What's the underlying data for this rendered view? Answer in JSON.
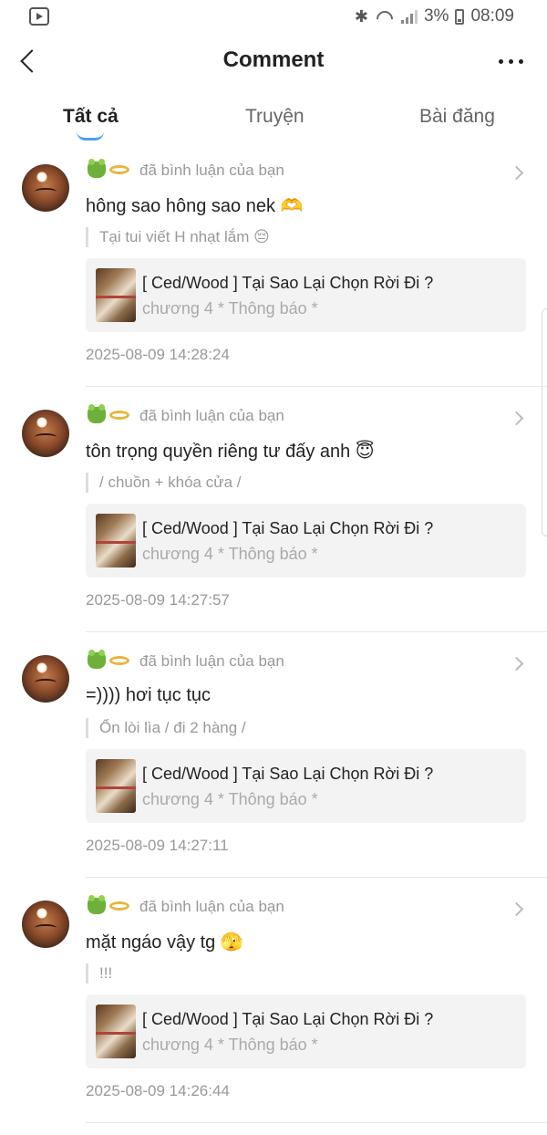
{
  "status_bar": {
    "battery": "3%",
    "time": "08:09"
  },
  "header": {
    "title": "Comment"
  },
  "tabs": [
    {
      "label": "Tất cả",
      "active": true
    },
    {
      "label": "Truyện",
      "active": false
    },
    {
      "label": "Bài đăng",
      "active": false
    }
  ],
  "colors": {
    "accent": "#4a9ff5",
    "muted_text": "#999999",
    "card_bg": "#f3f3f3"
  },
  "comments": [
    {
      "action": "đã bình luận của bạn",
      "text": "hông sao hông sao nek 🫶",
      "quote": "Tại tui viết H nhạt lắm 😔",
      "story_title": "[ Ced/Wood ] Tại Sao Lại Chọn Rời Đi ?",
      "story_sub": "chương 4 * Thông báo *",
      "timestamp": "2025-08-09 14:28:24"
    },
    {
      "action": "đã bình luận của bạn",
      "text": "tôn trọng quyền riêng tư đấy anh 😇",
      "quote": "/ chuồn + khóa cửa /",
      "story_title": "[ Ced/Wood ] Tại Sao Lại Chọn Rời Đi ?",
      "story_sub": "chương 4 * Thông báo *",
      "timestamp": "2025-08-09 14:27:57"
    },
    {
      "action": "đã bình luận của bạn",
      "text": "=)))) hơi tục tục",
      "quote": "Ổn lòi lìa / đi 2 hàng /",
      "story_title": "[ Ced/Wood ] Tại Sao Lại Chọn Rời Đi ?",
      "story_sub": "chương 4 * Thông báo *",
      "timestamp": "2025-08-09 14:27:11"
    },
    {
      "action": "đã bình luận của bạn",
      "text": "mặt ngáo vậy tg 🫣",
      "quote": "!!!",
      "story_title": "[ Ced/Wood ] Tại Sao Lại Chọn Rời Đi ?",
      "story_sub": "chương 4 * Thông báo *",
      "timestamp": "2025-08-09 14:26:44"
    }
  ]
}
